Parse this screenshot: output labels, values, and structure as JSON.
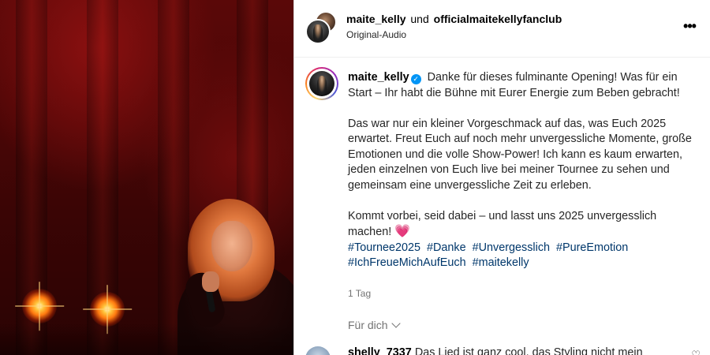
{
  "header": {
    "user1": "maite_kelly",
    "connector": "und",
    "user2": "officialmaitekellyfanclub",
    "audio": "Original-Audio",
    "more_icon": "more-horizontal-icon"
  },
  "post": {
    "username": "maite_kelly",
    "verified_icon": "verified-badge-icon",
    "paragraph1": "Danke für dieses fulminante Opening! Was für ein Start – Ihr habt die Bühne mit Eurer Energie zum Beben gebracht!",
    "paragraph2": "Das war nur ein kleiner Vorgeschmack auf das, was Euch 2025 erwartet. Freut Euch auf noch mehr unvergessliche Momente, große Emotionen und die volle Show-Power! Ich kann es kaum erwarten, jeden einzelnen von Euch live bei meiner Tournee zu sehen und gemeinsam eine unvergessliche Zeit zu erleben.",
    "paragraph3": "Kommt vorbei, seid dabei – und lasst uns 2025 unvergesslich machen!",
    "heart_emoji": "💗",
    "hashtags": [
      "#Tournee2025",
      "#Danke",
      "#Unvergesslich",
      "#PureEmotion",
      "#IchFreueMichAufEuch",
      "#maitekelly"
    ],
    "age": "1 Tag"
  },
  "comments": {
    "sort_label": "Für dich",
    "first": {
      "username": "shelly_7337",
      "text": "Das Lied ist ganz cool, das Styling nicht mein",
      "like_icon": "heart-outline-icon"
    }
  },
  "colors": {
    "link": "#00376b",
    "verified": "#0095f6",
    "muted": "#737373"
  }
}
